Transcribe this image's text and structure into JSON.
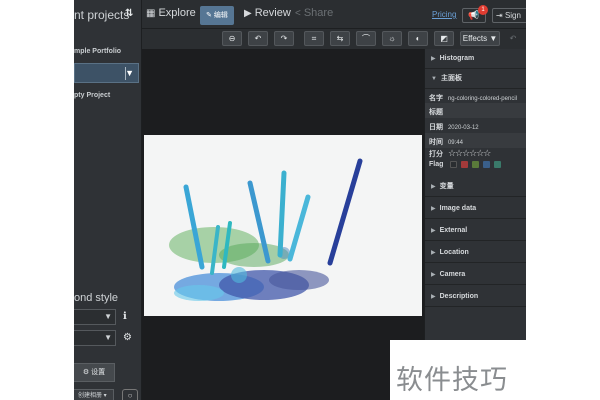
{
  "left_panel": {
    "title": "nt projects",
    "sort_icon": "sort-arrows-icon",
    "portfolio_label": "mple Portfolio",
    "empty_project_label": "pty Project",
    "section_title": "ond style",
    "settings_button": "设置",
    "create_label": "创建相册"
  },
  "nav": {
    "explore": "Explore",
    "edit": "编辑",
    "review": "Review",
    "share": "Share",
    "pricing": "Pricing",
    "notification_count": "1",
    "sign_in": "Sign"
  },
  "toolbar": {
    "effects": "Effects",
    "icons": [
      "minus-circle-icon",
      "rotate-left-icon",
      "rotate-right-icon",
      "crop-icon",
      "flip-icon",
      "curve-icon",
      "sun-icon",
      "contrast-icon",
      "image-adjust-icon",
      "undo-icon",
      "redo-icon"
    ]
  },
  "right_panel": {
    "histogram": "Histogram",
    "main_panel": "主面板",
    "name_label": "名字",
    "name_value": "ng-coloring-colored-pencil",
    "title_label": "标题",
    "date_label": "日期",
    "date_value": "2020-03-12",
    "time_label": "时间",
    "time_value": "09:44",
    "rating_label": "打分",
    "rating_value": 0,
    "flag_label": "Flag",
    "flag_colors": [
      "#2a2d30",
      "#a33a3a",
      "#5a7a3a",
      "#3a5f8a",
      "#3a7a6a"
    ],
    "sections": [
      "变量",
      "Image data",
      "External",
      "Location",
      "Camera",
      "Description"
    ]
  },
  "watermark": "软件技巧"
}
